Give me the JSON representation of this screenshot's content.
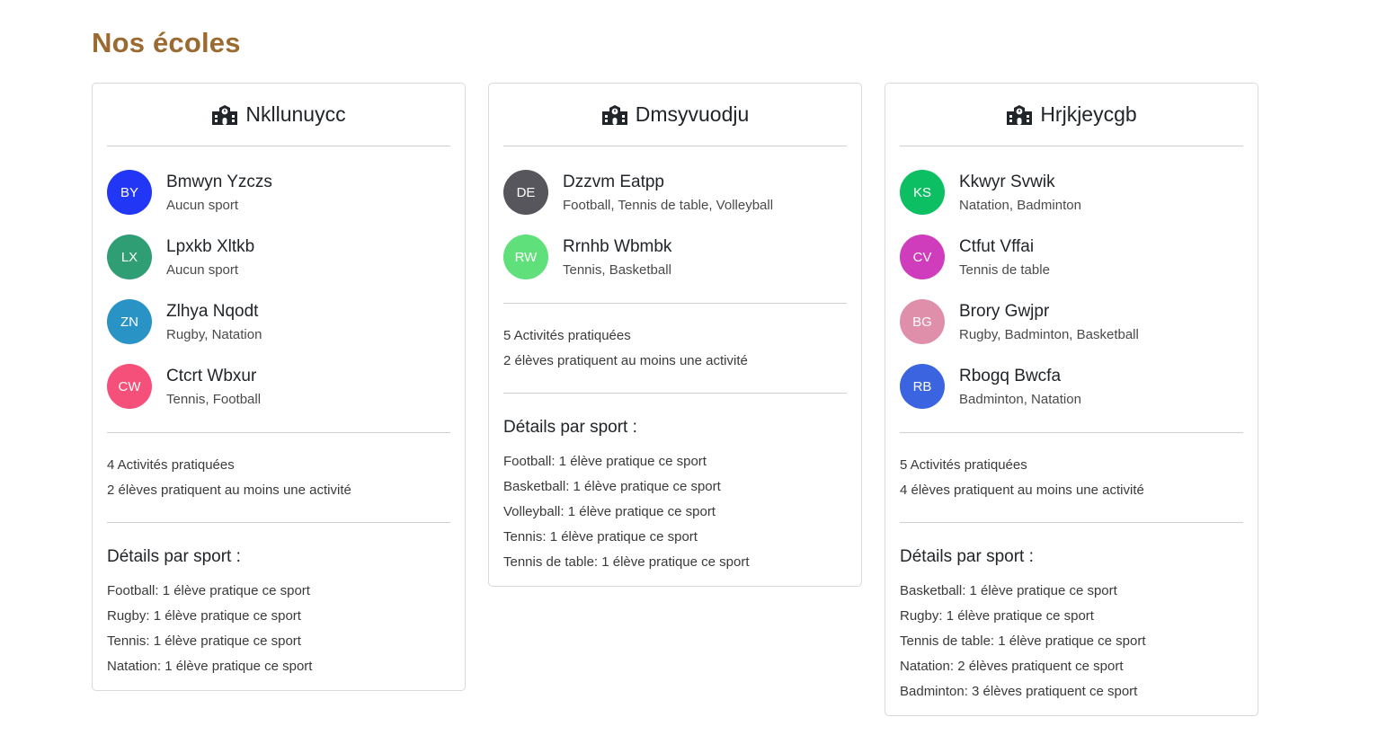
{
  "page": {
    "title": "Nos écoles"
  },
  "schools": [
    {
      "name": "Nkllunuycc",
      "students": [
        {
          "initials": "BY",
          "name": "Bmwyn Yzczs",
          "sports": "Aucun sport",
          "color": "#2236f5"
        },
        {
          "initials": "LX",
          "name": "Lpxkb Xltkb",
          "sports": "Aucun sport",
          "color": "#2f9e74"
        },
        {
          "initials": "ZN",
          "name": "Zlhya Nqodt",
          "sports": "Rugby, Natation",
          "color": "#2a93c5"
        },
        {
          "initials": "CW",
          "name": "Ctcrt Wbxur",
          "sports": "Tennis, Football",
          "color": "#f5507a"
        }
      ],
      "stats": {
        "activities": "4 Activités pratiquées",
        "students_active": "2 élèves pratiquent au moins une activité"
      },
      "details_title": "Détails par sport :",
      "details": [
        "Football: 1 élève pratique ce sport",
        "Rugby: 1 élève pratique ce sport",
        "Tennis: 1 élève pratique ce sport",
        "Natation: 1 élève pratique ce sport"
      ]
    },
    {
      "name": "Dmsyvuodju",
      "students": [
        {
          "initials": "DE",
          "name": "Dzzvm Eatpp",
          "sports": "Football, Tennis de table, Volleyball",
          "color": "#57565c"
        },
        {
          "initials": "RW",
          "name": "Rrnhb Wbmbk",
          "sports": "Tennis, Basketball",
          "color": "#5fe07a"
        }
      ],
      "stats": {
        "activities": "5 Activités pratiquées",
        "students_active": "2 élèves pratiquent au moins une activité"
      },
      "details_title": "Détails par sport :",
      "details": [
        "Football: 1 élève pratique ce sport",
        "Basketball: 1 élève pratique ce sport",
        "Volleyball: 1 élève pratique ce sport",
        "Tennis: 1 élève pratique ce sport",
        "Tennis de table: 1 élève pratique ce sport"
      ]
    },
    {
      "name": "Hrjkjeycgb",
      "students": [
        {
          "initials": "KS",
          "name": "Kkwyr Svwik",
          "sports": "Natation, Badminton",
          "color": "#0dbf63"
        },
        {
          "initials": "CV",
          "name": "Ctfut Vffai",
          "sports": "Tennis de table",
          "color": "#cf3cbc"
        },
        {
          "initials": "BG",
          "name": "Brory Gwjpr",
          "sports": "Rugby, Badminton, Basketball",
          "color": "#e08fab"
        },
        {
          "initials": "RB",
          "name": "Rbogq Bwcfa",
          "sports": "Badminton, Natation",
          "color": "#3a64e0"
        }
      ],
      "stats": {
        "activities": "5 Activités pratiquées",
        "students_active": "4 élèves pratiquent au moins une activité"
      },
      "details_title": "Détails par sport :",
      "details": [
        "Basketball: 1 élève pratique ce sport",
        "Rugby: 1 élève pratique ce sport",
        "Tennis de table: 1 élève pratique ce sport",
        "Natation: 2 élèves pratiquent ce sport",
        "Badminton: 3 élèves pratiquent ce sport"
      ]
    }
  ]
}
